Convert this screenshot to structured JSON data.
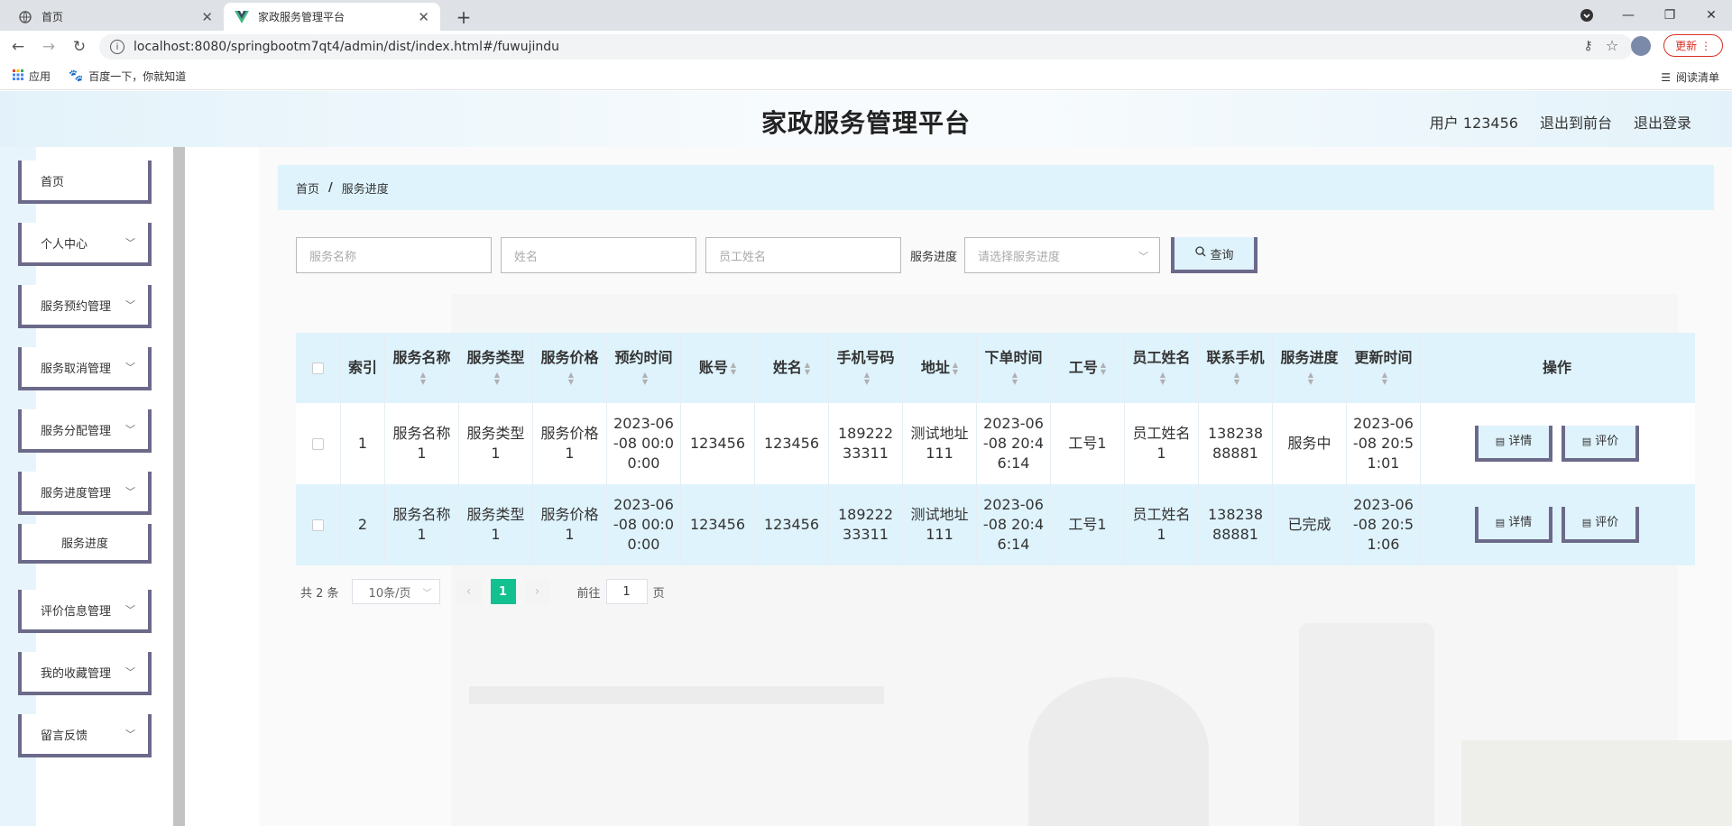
{
  "browser": {
    "tabs": [
      {
        "title": "首页",
        "active": false
      },
      {
        "title": "家政服务管理平台",
        "active": true
      }
    ],
    "url": "localhost:8080/springbootm7qt4/admin/dist/index.html#/fuwujindu",
    "update_label": "更新",
    "bookmarks": [
      {
        "label": "应用"
      },
      {
        "label": "百度一下，你就知道"
      }
    ],
    "reading_list": "阅读清单"
  },
  "header": {
    "title": "家政服务管理平台",
    "user": "用户 123456",
    "to_front": "退出到前台",
    "logout": "退出登录"
  },
  "sidebar": {
    "items": [
      {
        "label": "首页"
      },
      {
        "label": "个人中心"
      },
      {
        "label": "服务预约管理"
      },
      {
        "label": "服务取消管理"
      },
      {
        "label": "服务分配管理"
      },
      {
        "label": "服务进度管理"
      },
      {
        "label": "评价信息管理"
      },
      {
        "label": "我的收藏管理"
      },
      {
        "label": "留言反馈"
      }
    ],
    "sub_item": "服务进度"
  },
  "breadcrumb": {
    "home": "首页",
    "sep": "/",
    "current": "服务进度"
  },
  "search": {
    "service_name_placeholder": "服务名称",
    "name_placeholder": "姓名",
    "staff_name_placeholder": "员工姓名",
    "progress_label": "服务进度",
    "progress_placeholder": "请选择服务进度",
    "query_label": "查询"
  },
  "table": {
    "headers": [
      "索引",
      "服务名称",
      "服务类型",
      "服务价格",
      "预约时间",
      "账号",
      "姓名",
      "手机号码",
      "地址",
      "下单时间",
      "工号",
      "员工姓名",
      "联系手机",
      "服务进度",
      "更新时间",
      "操作"
    ],
    "rows": [
      {
        "index": "1",
        "service_name": "服务名称1",
        "service_type": "服务类型1",
        "price": "服务价格1",
        "appoint_time": "2023-06-08 00:00:00",
        "account": "123456",
        "name": "123456",
        "phone": "18922233311",
        "address": "测试地址111",
        "order_time": "2023-06-08 20:46:14",
        "staff_no": "工号1",
        "staff_name": "员工姓名1",
        "contact_phone": "13823888881",
        "progress": "服务中",
        "update_time": "2023-06-08 20:51:01"
      },
      {
        "index": "2",
        "service_name": "服务名称1",
        "service_type": "服务类型1",
        "price": "服务价格1",
        "appoint_time": "2023-06-08 00:00:00",
        "account": "123456",
        "name": "123456",
        "phone": "18922233311",
        "address": "测试地址111",
        "order_time": "2023-06-08 20:46:14",
        "staff_no": "工号1",
        "staff_name": "员工姓名1",
        "contact_phone": "13823888881",
        "progress": "已完成",
        "update_time": "2023-06-08 20:51:06"
      }
    ],
    "detail_label": "详情",
    "review_label": "评价"
  },
  "pagination": {
    "total": "共 2 条",
    "page_size": "10条/页",
    "current_page": "1",
    "goto_label": "前往",
    "goto_value": "1",
    "page_unit": "页"
  }
}
